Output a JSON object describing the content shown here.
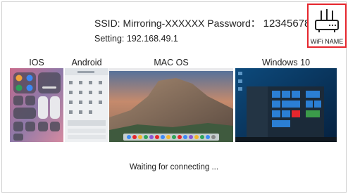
{
  "header": {
    "ssid_prefix": "SSID: Mirroring-XXXXXX Password：",
    "password": "12345678",
    "setting": "Setting: 192.168.49.1",
    "wifi_name": "WiFi NAME"
  },
  "platforms": [
    {
      "label": "IOS"
    },
    {
      "label": "Android"
    },
    {
      "label": "MAC OS"
    },
    {
      "label": "Windows 10"
    }
  ],
  "status": "Waiting for connecting ...",
  "colors": {
    "accent": "#e5262d"
  }
}
